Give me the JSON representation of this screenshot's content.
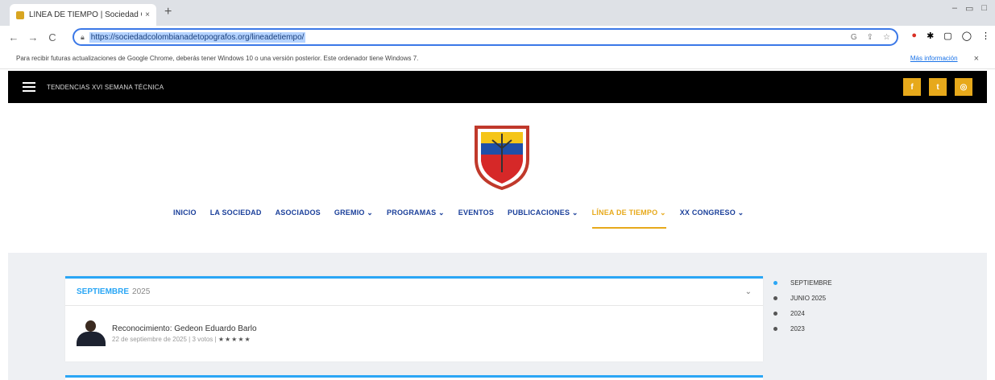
{
  "browser": {
    "tab_title": "LÍNEA DE TIEMPO | Sociedad Colom...",
    "tab_close": "×",
    "new_tab": "+",
    "window_controls": [
      "–",
      "▭",
      "□"
    ],
    "nav": {
      "back": "←",
      "forward": "→",
      "reload": "C"
    },
    "url": "https://sociedadcolombianadetopografos.org/lineadetiempo/",
    "info_message": "Para recibir futuras actualizaciones de Google Chrome, deberás tener Windows 10 o una versión posterior. Este ordenador tiene Windows 7.",
    "info_more": "Más información",
    "info_close": "×"
  },
  "site": {
    "ticker": "TENDENCIAS XVI SEMANA TÉCNICA",
    "social": [
      "f",
      "t",
      "◎"
    ],
    "nav": [
      {
        "label": "INICIO",
        "active": false
      },
      {
        "label": "LA SOCIEDAD",
        "active": false
      },
      {
        "label": "ASOCIADOS",
        "active": false
      },
      {
        "label": "GREMIO ⌄",
        "active": false
      },
      {
        "label": "PROGRAMAS ⌄",
        "active": false
      },
      {
        "label": "EVENTOS",
        "active": false
      },
      {
        "label": "PUBLICACIONES ⌄",
        "active": false
      },
      {
        "label": "LÍNEA DE TIEMPO ⌄",
        "active": true
      },
      {
        "label": "XX CONGRESO ⌄",
        "active": false
      }
    ]
  },
  "timeline": {
    "card": {
      "month": "SEPTIEMBRE",
      "year": "2025",
      "chevron": "⌄",
      "entry_title": "Reconocimiento: Gedeon Eduardo Barlo",
      "entry_meta": "22 de septiembre de 2025 | 3 votos |",
      "stars": "★★★★★"
    },
    "side_items": [
      "SEPTIEMBRE",
      "JUNIO 2025",
      "2024",
      "2023"
    ]
  }
}
